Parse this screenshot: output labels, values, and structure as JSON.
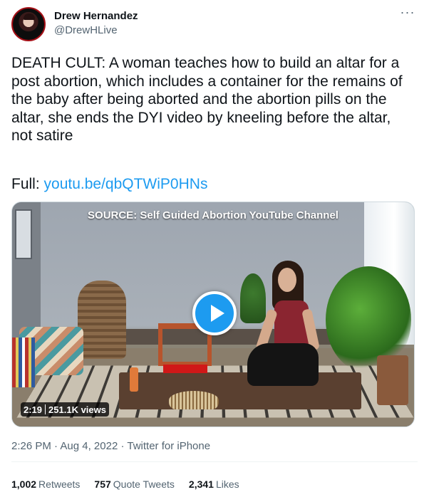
{
  "author": {
    "display_name": "Drew Hernandez",
    "handle": "@DrewHLive"
  },
  "menu": {
    "more_icon": "more-horizontal-icon",
    "more_glyph": "···"
  },
  "tweet": {
    "text": "DEATH CULT: A woman teaches how to build an altar for a post abortion, which includes a container for the remains of the baby after being aborted and the abortion pills on the altar, she ends the DYI video by kneeling before the altar, not satire",
    "full_label": "Full: ",
    "link_text": "youtu.be/qbQTWiP0HNs"
  },
  "media": {
    "caption": "SOURCE: Self Guided Abortion YouTube Channel",
    "duration": "2:19",
    "views": "251.1K views",
    "play_icon": "play-icon",
    "accent": "#1d9bf0"
  },
  "meta": {
    "time": "2:26 PM",
    "dot1": " · ",
    "date": "Aug 4, 2022",
    "dot2": " · ",
    "source": "Twitter for iPhone"
  },
  "stats": {
    "retweets_count": "1,002",
    "retweets_label": "Retweets",
    "quotes_count": "757",
    "quotes_label": "Quote Tweets",
    "likes_count": "2,341",
    "likes_label": "Likes"
  },
  "colors": {
    "text_primary": "#0f1419",
    "text_secondary": "#536471",
    "link": "#1d9bf0"
  }
}
